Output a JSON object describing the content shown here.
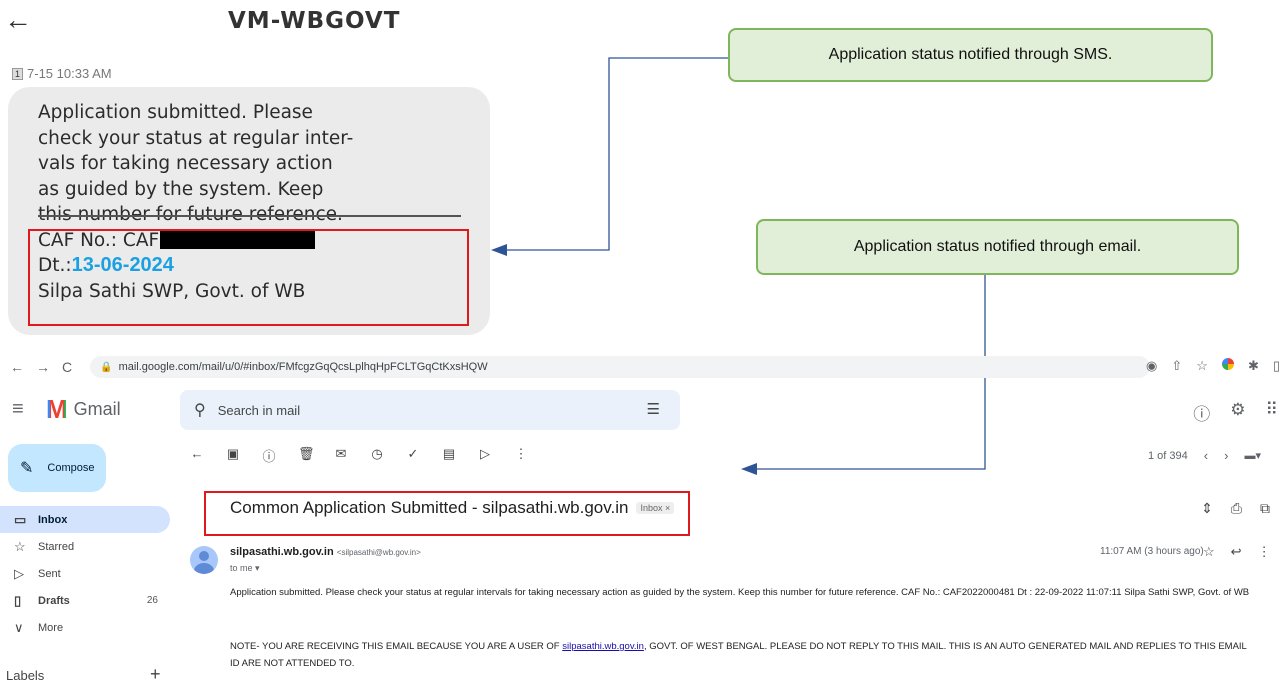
{
  "sms": {
    "back_icon": "←",
    "sender": "VM-WBGOVT",
    "sim_badge": "1",
    "timestamp": "7-15 10:33 AM",
    "lines": [
      "Application submitted. Please",
      "check your status at regular inter-",
      "vals for taking necessary action",
      "as guided by the system. Keep",
      "this number for future reference."
    ],
    "caf_label": "CAF No.: CAF",
    "date_prefix": "Dt.:",
    "date": "13-06-2024",
    "signature": "Silpa Sathi SWP, Govt. of WB"
  },
  "callouts": {
    "sms": "Application status notified through SMS.",
    "email": "Application status notified through email."
  },
  "colors": {
    "highlight_box": "#e0191c",
    "callout_fill": "#e2efd8",
    "callout_border": "#7fb65c",
    "connector": "#2f5496",
    "date_text": "#1ba1e2",
    "compose_bg": "#c2e7ff",
    "inbox_active_bg": "#d3e3fd"
  },
  "browser": {
    "nav": [
      "←",
      "→",
      "C"
    ],
    "url": "mail.google.com/mail/u/0/#inbox/FMfcgzGqQcsLplhqHpFCLTGqCtKxsHQW",
    "extension_icons": [
      "location-icon",
      "share-icon",
      "star-icon",
      "chrome-icon",
      "puzzle-icon",
      "sidepanel-icon"
    ]
  },
  "gmail": {
    "menu_icon": "≡",
    "app_name": "Gmail",
    "search_placeholder": "Search in mail",
    "top_icons": [
      "help-icon",
      "settings-icon",
      "apps-icon"
    ],
    "compose_label": "Compose",
    "nav": [
      {
        "icon": "inbox-icon",
        "glyph": "▭",
        "label": "Inbox",
        "count": ""
      },
      {
        "icon": "star-icon",
        "glyph": "☆",
        "label": "Starred",
        "count": ""
      },
      {
        "icon": "sent-icon",
        "glyph": "▷",
        "label": "Sent",
        "count": ""
      },
      {
        "icon": "drafts-icon",
        "glyph": "▯",
        "label": "Drafts",
        "count": "26"
      },
      {
        "icon": "more-icon",
        "glyph": "∨",
        "label": "More",
        "count": ""
      }
    ],
    "labels_header": "Labels",
    "pager_text": "1 of 394",
    "subject": "Common Application Submitted - silpasathi.wb.gov.in",
    "subject_chip": "Inbox ×",
    "sender_name": "silpasathi.wb.gov.in",
    "sender_email": "<silpasathi@wb.gov.in>",
    "to_line": "to me ▾",
    "time": "11:07 AM (3 hours ago)",
    "body_line": "Application submitted. Please check your status at regular intervals for taking necessary action as guided by the system. Keep this number for future reference. CAF No.: CAF2022000481 Dt : 22-09-2022 11:07:11 Silpa Sathi SWP, Govt. of WB",
    "note_prefix": "NOTE- YOU ARE RECEIVING THIS EMAIL BECAUSE YOU ARE A USER OF ",
    "note_link": "silpasathi.wb.gov.in",
    "note_suffix": ", GOVT. OF WEST BENGAL. PLEASE DO NOT REPLY TO THIS MAIL. THIS IS AN AUTO GENERATED MAIL AND REPLIES TO THIS EMAIL ID ARE NOT ATTENDED TO."
  }
}
